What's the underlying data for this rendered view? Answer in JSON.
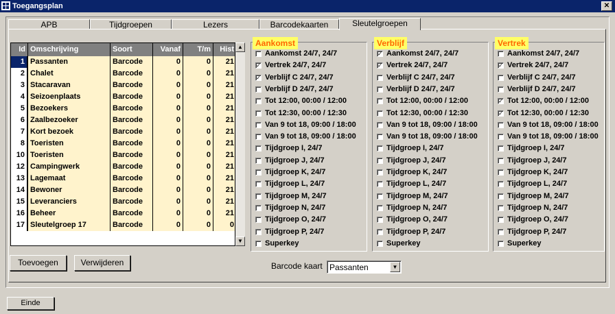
{
  "window": {
    "title": "Toegangsplan"
  },
  "tabs": [
    {
      "label": "APB",
      "active": false
    },
    {
      "label": "Tijdgroepen",
      "active": false
    },
    {
      "label": "Lezers",
      "active": false
    },
    {
      "label": "Barcodekaarten",
      "active": false
    },
    {
      "label": "Sleutelgroepen",
      "active": true
    }
  ],
  "grid": {
    "headers": {
      "id": "Id",
      "omschrijving": "Omschrijving",
      "soort": "Soort",
      "vanaf": "Vanaf",
      "tm": "T/m",
      "hist": "Hist"
    },
    "rows": [
      {
        "id": "1",
        "omschrijving": "Passanten",
        "soort": "Barcode",
        "vanaf": "0",
        "tm": "0",
        "hist": "21"
      },
      {
        "id": "2",
        "omschrijving": "Chalet",
        "soort": "Barcode",
        "vanaf": "0",
        "tm": "0",
        "hist": "21"
      },
      {
        "id": "3",
        "omschrijving": "Stacaravan",
        "soort": "Barcode",
        "vanaf": "0",
        "tm": "0",
        "hist": "21"
      },
      {
        "id": "4",
        "omschrijving": "Seizoenplaats",
        "soort": "Barcode",
        "vanaf": "0",
        "tm": "0",
        "hist": "21"
      },
      {
        "id": "5",
        "omschrijving": "Bezoekers",
        "soort": "Barcode",
        "vanaf": "0",
        "tm": "0",
        "hist": "21"
      },
      {
        "id": "6",
        "omschrijving": "Zaalbezoeker",
        "soort": "Barcode",
        "vanaf": "0",
        "tm": "0",
        "hist": "21"
      },
      {
        "id": "7",
        "omschrijving": "Kort bezoek",
        "soort": "Barcode",
        "vanaf": "0",
        "tm": "0",
        "hist": "21"
      },
      {
        "id": "8",
        "omschrijving": "Toeristen",
        "soort": "Barcode",
        "vanaf": "0",
        "tm": "0",
        "hist": "21"
      },
      {
        "id": "10",
        "omschrijving": "Toeristen",
        "soort": "Barcode",
        "vanaf": "0",
        "tm": "0",
        "hist": "21"
      },
      {
        "id": "12",
        "omschrijving": "Campingwerk",
        "soort": "Barcode",
        "vanaf": "0",
        "tm": "0",
        "hist": "21"
      },
      {
        "id": "13",
        "omschrijving": "Lagemaat",
        "soort": "Barcode",
        "vanaf": "0",
        "tm": "0",
        "hist": "21"
      },
      {
        "id": "14",
        "omschrijving": "Bewoner",
        "soort": "Barcode",
        "vanaf": "0",
        "tm": "0",
        "hist": "21"
      },
      {
        "id": "15",
        "omschrijving": "Leveranciers",
        "soort": "Barcode",
        "vanaf": "0",
        "tm": "0",
        "hist": "21"
      },
      {
        "id": "16",
        "omschrijving": "Beheer",
        "soort": "Barcode",
        "vanaf": "0",
        "tm": "0",
        "hist": "21"
      },
      {
        "id": "17",
        "omschrijving": "Sleutelgroep 17",
        "soort": "Barcode",
        "vanaf": "0",
        "tm": "0",
        "hist": "0"
      }
    ]
  },
  "groups": [
    {
      "title": "Aankomst",
      "items": [
        {
          "label": "Aankomst 24/7, 24/7",
          "checked": false
        },
        {
          "label": "Vertrek 24/7, 24/7",
          "checked": true
        },
        {
          "label": "Verblijf C 24/7, 24/7",
          "checked": true
        },
        {
          "label": "Verblijf D 24/7, 24/7",
          "checked": false
        },
        {
          "label": "Tot 12:00, 00:00 / 12:00",
          "checked": false
        },
        {
          "label": "Tot 12:30, 00:00 / 12:30",
          "checked": false
        },
        {
          "label": "Van 9 tot 18, 09:00 / 18:00",
          "checked": false
        },
        {
          "label": "Van 9 tot 18, 09:00 / 18:00",
          "checked": false
        },
        {
          "label": "Tijdgroep I, 24/7",
          "checked": false
        },
        {
          "label": "Tijdgroep J, 24/7",
          "checked": false
        },
        {
          "label": "Tijdgroep K, 24/7",
          "checked": false
        },
        {
          "label": "Tijdgroep L, 24/7",
          "checked": false
        },
        {
          "label": "Tijdgroep M, 24/7",
          "checked": false
        },
        {
          "label": "Tijdgroep N, 24/7",
          "checked": false
        },
        {
          "label": "Tijdgroep O, 24/7",
          "checked": false
        },
        {
          "label": "Tijdgroep P, 24/7",
          "checked": false
        },
        {
          "label": "Superkey",
          "checked": false
        }
      ]
    },
    {
      "title": "Verblijf",
      "items": [
        {
          "label": "Aankomst 24/7, 24/7",
          "checked": true
        },
        {
          "label": "Vertrek 24/7, 24/7",
          "checked": true
        },
        {
          "label": "Verblijf C 24/7, 24/7",
          "checked": false
        },
        {
          "label": "Verblijf D 24/7, 24/7",
          "checked": false
        },
        {
          "label": "Tot 12:00, 00:00 / 12:00",
          "checked": false
        },
        {
          "label": "Tot 12:30, 00:00 / 12:30",
          "checked": false
        },
        {
          "label": "Van 9 tot 18, 09:00 / 18:00",
          "checked": false
        },
        {
          "label": "Van 9 tot 18, 09:00 / 18:00",
          "checked": false
        },
        {
          "label": "Tijdgroep I, 24/7",
          "checked": false
        },
        {
          "label": "Tijdgroep J, 24/7",
          "checked": false
        },
        {
          "label": "Tijdgroep K, 24/7",
          "checked": false
        },
        {
          "label": "Tijdgroep L, 24/7",
          "checked": false
        },
        {
          "label": "Tijdgroep M, 24/7",
          "checked": false
        },
        {
          "label": "Tijdgroep N, 24/7",
          "checked": false
        },
        {
          "label": "Tijdgroep O, 24/7",
          "checked": false
        },
        {
          "label": "Tijdgroep P, 24/7",
          "checked": false
        },
        {
          "label": "Superkey",
          "checked": false
        }
      ]
    },
    {
      "title": "Vertrek",
      "items": [
        {
          "label": "Aankomst 24/7, 24/7",
          "checked": false
        },
        {
          "label": "Vertrek 24/7, 24/7",
          "checked": true
        },
        {
          "label": "Verblijf C 24/7, 24/7",
          "checked": false
        },
        {
          "label": "Verblijf D 24/7, 24/7",
          "checked": false
        },
        {
          "label": "Tot 12:00, 00:00 / 12:00",
          "checked": true
        },
        {
          "label": "Tot 12:30, 00:00 / 12:30",
          "checked": true
        },
        {
          "label": "Van 9 tot 18, 09:00 / 18:00",
          "checked": false
        },
        {
          "label": "Van 9 tot 18, 09:00 / 18:00",
          "checked": false
        },
        {
          "label": "Tijdgroep I, 24/7",
          "checked": false
        },
        {
          "label": "Tijdgroep J, 24/7",
          "checked": false
        },
        {
          "label": "Tijdgroep K, 24/7",
          "checked": false
        },
        {
          "label": "Tijdgroep L, 24/7",
          "checked": false
        },
        {
          "label": "Tijdgroep M, 24/7",
          "checked": false
        },
        {
          "label": "Tijdgroep N, 24/7",
          "checked": false
        },
        {
          "label": "Tijdgroep O, 24/7",
          "checked": false
        },
        {
          "label": "Tijdgroep P, 24/7",
          "checked": false
        },
        {
          "label": "Superkey",
          "checked": false
        }
      ]
    }
  ],
  "buttons": {
    "toevoegen": "Toevoegen",
    "verwijderen": "Verwijderen",
    "einde": "Einde"
  },
  "barcode": {
    "label": "Barcode kaart",
    "value": "Passanten"
  },
  "icons": {
    "app": "app-icon",
    "close": "close-icon",
    "checkbox_mark": "✓",
    "scroll_up": "▲",
    "scroll_down": "▼",
    "dropdown": "▼"
  },
  "colors": {
    "titlebar": "#0a246a",
    "row_bg": "#fff3cc",
    "legend_bg": "#ffff66",
    "legend_text": "#ff6600"
  }
}
